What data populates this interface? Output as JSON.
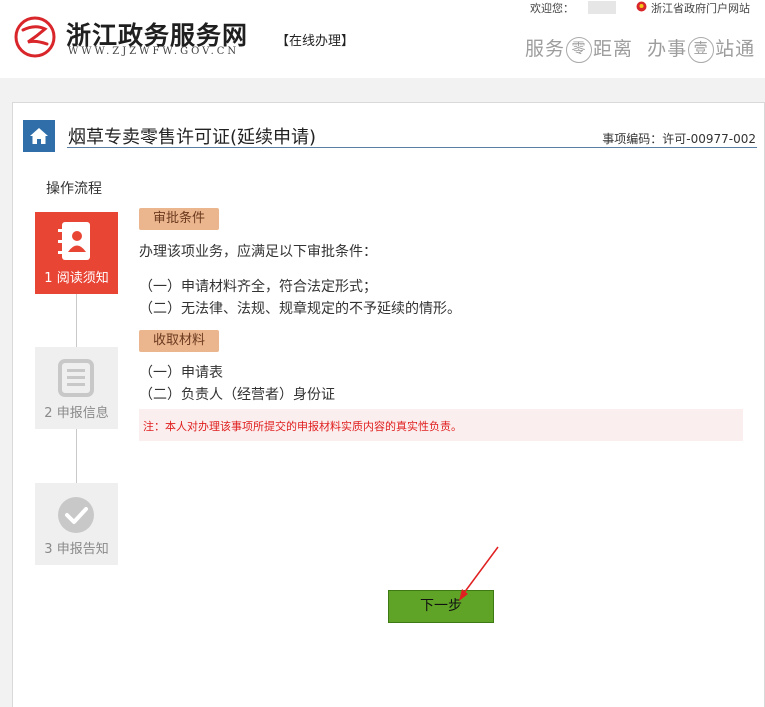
{
  "header": {
    "site_title": "浙江政务服务网",
    "site_url": "WWW.ZJZWFW.GOV.CN",
    "section_tag": "【在线办理】",
    "welcome": "欢迎您：",
    "portal_link": "浙江省政府门户网站",
    "slogan": {
      "part1": "服务",
      "circle1": "零",
      "part2": "距离",
      "part3": "办事",
      "circle2": "壹",
      "part4": "站通"
    }
  },
  "page": {
    "title": "烟草专卖零售许可证(延续申请)",
    "item_code": "事项编码：许可-00977-002"
  },
  "flow": {
    "title": "操作流程",
    "steps": [
      {
        "label": "1 阅读须知",
        "state": "active"
      },
      {
        "label": "2 申报信息",
        "state": "inactive"
      },
      {
        "label": "3 申报告知",
        "state": "inactive"
      }
    ]
  },
  "conditions": {
    "tag": "审批条件",
    "intro": "办理该项业务，应满足以下审批条件：",
    "items": [
      "（一）申请材料齐全，符合法定形式；",
      "（二）无法律、法规、规章规定的不予延续的情形。"
    ]
  },
  "materials": {
    "tag": "收取材料",
    "items": [
      "（一）申请表",
      "（二）负责人（经营者）身份证"
    ]
  },
  "notice": "注：本人对办理该事项所提交的申报材料实质内容的真实性负责。",
  "next_button": "下一步",
  "colors": {
    "active_step": "#e94535",
    "tag_bg": "#ebb58e",
    "button": "#5fa426",
    "notice_text": "#e02020",
    "home": "#2f6ea9"
  }
}
